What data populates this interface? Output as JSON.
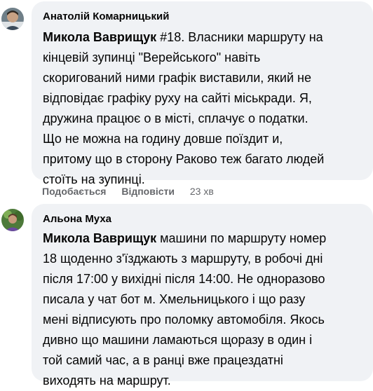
{
  "comments": [
    {
      "author": "Анатолій Комарницький",
      "mention": "Микола Ваврищук",
      "lines": [
        " #18. Власники маршруту на",
        "кінцевій зупинці \"Верейського\" навіть",
        "скоригований ними графік виставили, який не",
        "відповідає графіку руху на сайті міськради. Я,",
        "дружина працює о в місті, сплачує о податки.",
        "Що не можна на годину довше поїздит и,",
        "притому що в сторону Раково теж багато людей",
        "стоїть на зупинці."
      ],
      "like_label": "Подобається",
      "reply_label": "Відповісти",
      "time": "23 хв"
    },
    {
      "author": "Альона Муха",
      "mention": "Микола Ваврищук",
      "lines": [
        " машини по маршруту номер",
        "18 щоденно з'їзджають з маршруту, в робочі дні",
        "після 17:00 у вихідні після 14:00. Не одноразово",
        "писала у чат бот м. Хмельницького і що разу",
        "мені відписують про поломку автомобіля. Якось",
        "дивно що машини ламаються щоразу в один і",
        "той самий час, а в ранці вже працездатні",
        "виходять на маршрут."
      ]
    }
  ],
  "colors": {
    "bubble_bg": "#f0f2f5",
    "secondary_text": "#65676b",
    "primary_text": "#050505"
  }
}
